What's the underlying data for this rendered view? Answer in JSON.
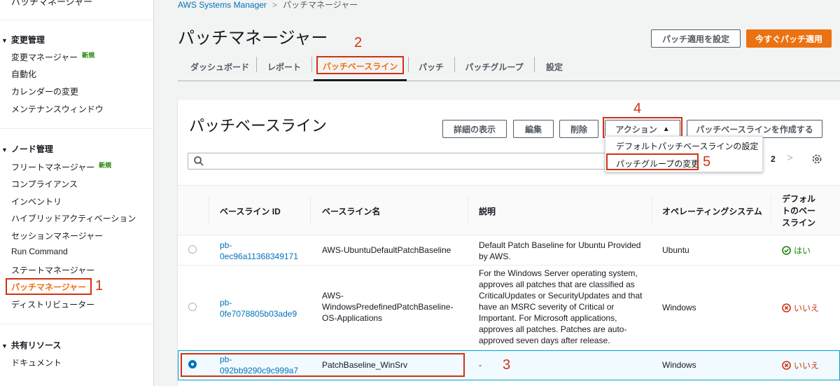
{
  "sidebar": {
    "cut_item": "パッチマネージャー",
    "change_section": "変更管理",
    "change_items": [
      "変更マネージャー",
      "自動化",
      "カレンダーの変更",
      "メンテナンスウィンドウ"
    ],
    "new_badge": "新規",
    "node_section": "ノード管理",
    "node_items": [
      "フリートマネージャー",
      "コンプライアンス",
      "インベントリ",
      "ハイブリッドアクティベーション",
      "セッションマネージャー",
      "Run Command",
      "ステートマネージャー",
      "パッチマネージャー",
      "ディストリビューター"
    ],
    "shared_section": "共有リソース",
    "shared_items": [
      "ドキュメント"
    ]
  },
  "breadcrumb": {
    "root": "AWS Systems Manager",
    "current": "パッチマネージャー"
  },
  "page_title": "パッチマネージャー",
  "header_buttons": {
    "configure": "パッチ適用を設定",
    "patch_now": "今すぐパッチ適用"
  },
  "tabs": [
    "ダッシュボード",
    "レポート",
    "パッチベースライン",
    "パッチ",
    "パッチグループ",
    "設定"
  ],
  "panel": {
    "title": "パッチベースライン",
    "buttons": {
      "details": "詳細の表示",
      "edit": "編集",
      "delete": "削除",
      "actions": "アクション",
      "create": "パッチベースラインを作成する"
    },
    "dropdown": [
      "デフォルトパッチベースラインの設定",
      "パッチグループの変更"
    ],
    "page_number": "2"
  },
  "table": {
    "headers": [
      "ベースライン ID",
      "ベースライン名",
      "説明",
      "オペレーティングシステム",
      "デフォルトのベースライン"
    ],
    "rows": [
      {
        "id_1": "pb-",
        "id_2": "0ec96a11368349171",
        "name": "AWS-UbuntuDefaultPatchBaseline",
        "desc": [
          "Default Patch Baseline for Ubuntu Provided",
          "by AWS."
        ],
        "os": "Ubuntu",
        "default": "はい"
      },
      {
        "id_1": "pb-",
        "id_2": "0fe7078805b03ade9",
        "name": "AWS-WindowsPredefinedPatchBaseline-OS-Applications",
        "desc": [
          "For the Windows Server operating system,",
          "approves all patches that are classified as",
          "CriticalUpdates or SecurityUpdates and that",
          "have an MSRC severity of Critical or",
          "Important. For Microsoft applications,",
          "approves all patches. Patches are auto-",
          "approved seven days after release."
        ],
        "os": "Windows",
        "default": "いいえ"
      },
      {
        "id_1": "pb-",
        "id_2": "092bb9290c9c999a7",
        "name": "PatchBaseline_WinSrv",
        "desc": [
          "-"
        ],
        "os": "Windows",
        "default": "いいえ"
      }
    ]
  },
  "annotations": [
    "1",
    "2",
    "3",
    "4",
    "5"
  ],
  "colors": {
    "accent": "#ec7211",
    "link": "#0073bb",
    "annotation": "#d13212",
    "ok": "#1d8102"
  }
}
